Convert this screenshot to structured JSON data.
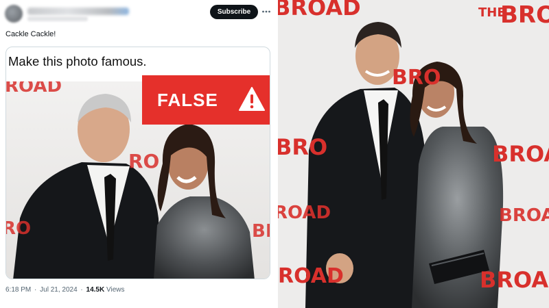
{
  "post": {
    "subscribe_label": "Subscribe",
    "more_icon": "more-horizontal-icon",
    "text": "Cackle Cackle!",
    "media": {
      "caption": "Make this photo famous.",
      "false_label": "FALSE",
      "warning_icon": "warning-triangle-icon",
      "background_wordmark_top": "ROAD",
      "background_wordmark_mid": "RO",
      "background_wordmark_left": "RO",
      "background_wordmark_right": "BRO"
    },
    "meta": {
      "time": "6:18 PM",
      "date": "Jul 21, 2024",
      "views_count": "14.5K",
      "views_label": "Views"
    }
  },
  "photo": {
    "backdrop": {
      "top_left": "BROAD",
      "top_right_the": "THE",
      "top_right_broad": "BROAD",
      "mid_right": "BROA",
      "mid_left": "BRO",
      "center": "BRO",
      "left_row3": "ROAD",
      "right_row3": "BROAD",
      "bottom_left": "ROAD",
      "bottom_right": "BROAD"
    }
  },
  "colors": {
    "label_red": "#e5302b",
    "brand_red": "#d8302c",
    "button_dark": "#0f1419",
    "muted_text": "#536471"
  }
}
